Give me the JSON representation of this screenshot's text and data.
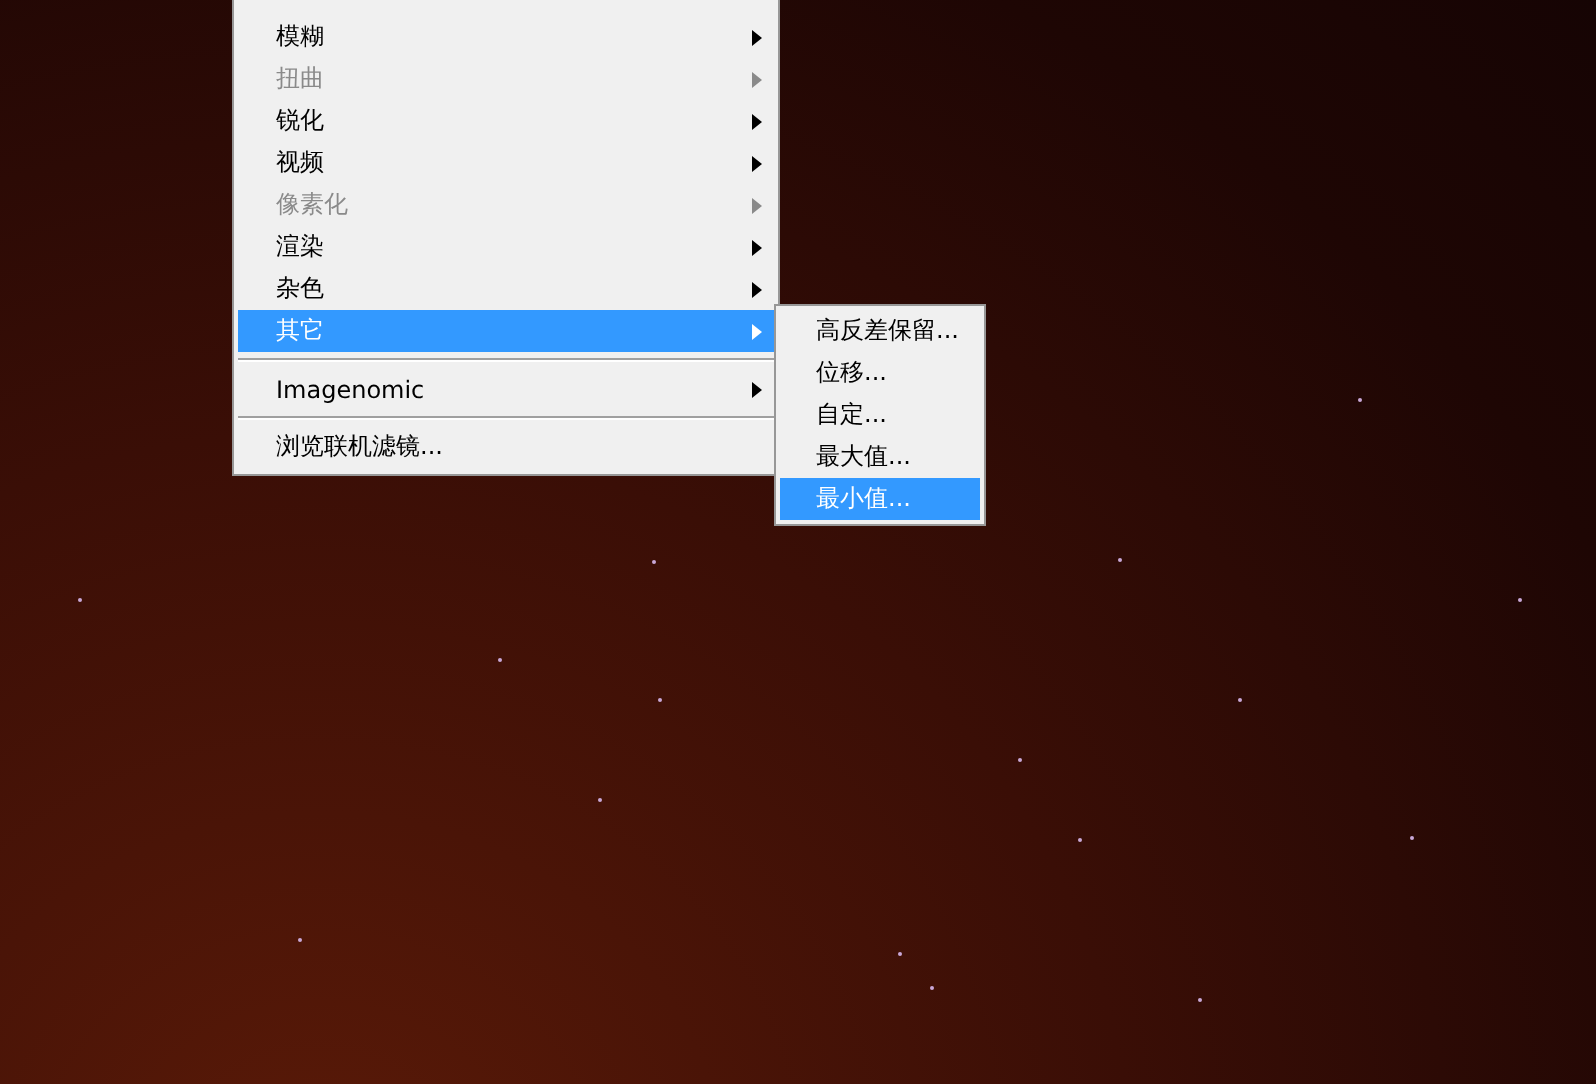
{
  "menu": {
    "items": [
      {
        "kind": "submenu",
        "label": "模糊",
        "disabled": false,
        "selected": false
      },
      {
        "kind": "submenu",
        "label": "扭曲",
        "disabled": true,
        "selected": false
      },
      {
        "kind": "submenu",
        "label": "锐化",
        "disabled": false,
        "selected": false
      },
      {
        "kind": "submenu",
        "label": "视频",
        "disabled": false,
        "selected": false
      },
      {
        "kind": "submenu",
        "label": "像素化",
        "disabled": true,
        "selected": false
      },
      {
        "kind": "submenu",
        "label": "渲染",
        "disabled": false,
        "selected": false
      },
      {
        "kind": "submenu",
        "label": "杂色",
        "disabled": false,
        "selected": false
      },
      {
        "kind": "submenu",
        "label": "其它",
        "disabled": false,
        "selected": true
      },
      {
        "kind": "separator"
      },
      {
        "kind": "submenu",
        "label": "Imagenomic",
        "disabled": false,
        "selected": false
      },
      {
        "kind": "separator"
      },
      {
        "kind": "action",
        "label": "浏览联机滤镜...",
        "disabled": false,
        "selected": false
      }
    ]
  },
  "submenu": {
    "items": [
      {
        "label": "高反差保留...",
        "selected": false
      },
      {
        "label": "位移...",
        "selected": false
      },
      {
        "label": "自定...",
        "selected": false
      },
      {
        "label": "最大值...",
        "selected": false
      },
      {
        "label": "最小值...",
        "selected": true
      }
    ]
  }
}
